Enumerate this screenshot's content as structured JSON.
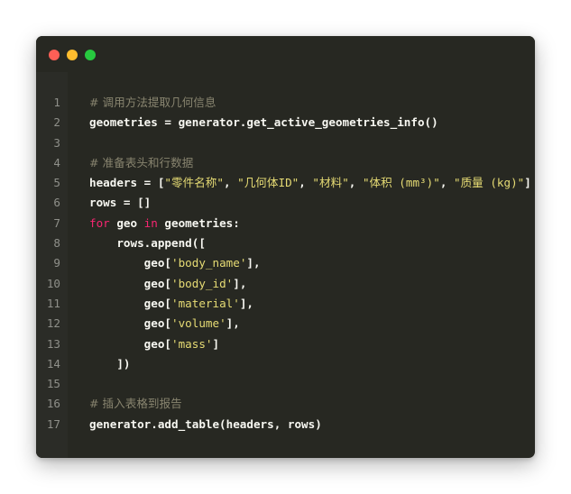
{
  "window": {
    "traffic_lights": [
      {
        "name": "close",
        "color": "#ff5f56"
      },
      {
        "name": "minimize",
        "color": "#ffbd2e"
      },
      {
        "name": "maximize",
        "color": "#27c93f"
      }
    ]
  },
  "theme": {
    "background": "#272822",
    "text": "#f8f8f2",
    "string": "#e6db74",
    "keyword": "#f92672",
    "comment": "#88846f",
    "line_number": "#8f908a"
  },
  "code": {
    "lines": [
      {
        "number": "1",
        "tokens": [
          {
            "t": "cm",
            "v": "# 调用方法提取几何信息"
          }
        ]
      },
      {
        "number": "2",
        "tokens": [
          {
            "t": "code",
            "v": "geometries = generator.get_active_geometries_info()"
          }
        ]
      },
      {
        "number": "3",
        "tokens": []
      },
      {
        "number": "4",
        "tokens": [
          {
            "t": "cm",
            "v": "# 准备表头和行数据"
          }
        ]
      },
      {
        "number": "5",
        "tokens": [
          {
            "t": "code",
            "v": "headers = ["
          },
          {
            "t": "str",
            "v": "\"零件名称\""
          },
          {
            "t": "code",
            "v": ", "
          },
          {
            "t": "str",
            "v": "\"几何体ID\""
          },
          {
            "t": "code",
            "v": ", "
          },
          {
            "t": "str",
            "v": "\"材料\""
          },
          {
            "t": "code",
            "v": ", "
          },
          {
            "t": "str",
            "v": "\"体积 (mm³)\""
          },
          {
            "t": "code",
            "v": ", "
          },
          {
            "t": "str",
            "v": "\"质量 (kg)\""
          },
          {
            "t": "code",
            "v": "]"
          }
        ]
      },
      {
        "number": "6",
        "tokens": [
          {
            "t": "code",
            "v": "rows = []"
          }
        ]
      },
      {
        "number": "7",
        "tokens": [
          {
            "t": "kw",
            "v": "for"
          },
          {
            "t": "code",
            "v": " geo "
          },
          {
            "t": "kw",
            "v": "in"
          },
          {
            "t": "code",
            "v": " geometries:"
          }
        ]
      },
      {
        "number": "8",
        "tokens": [
          {
            "t": "code",
            "v": "    rows.append(["
          }
        ]
      },
      {
        "number": "9",
        "tokens": [
          {
            "t": "code",
            "v": "        geo["
          },
          {
            "t": "str",
            "v": "'body_name'"
          },
          {
            "t": "code",
            "v": "],"
          }
        ]
      },
      {
        "number": "10",
        "tokens": [
          {
            "t": "code",
            "v": "        geo["
          },
          {
            "t": "str",
            "v": "'body_id'"
          },
          {
            "t": "code",
            "v": "],"
          }
        ]
      },
      {
        "number": "11",
        "tokens": [
          {
            "t": "code",
            "v": "        geo["
          },
          {
            "t": "str",
            "v": "'material'"
          },
          {
            "t": "code",
            "v": "],"
          }
        ]
      },
      {
        "number": "12",
        "tokens": [
          {
            "t": "code",
            "v": "        geo["
          },
          {
            "t": "str",
            "v": "'volume'"
          },
          {
            "t": "code",
            "v": "],"
          }
        ]
      },
      {
        "number": "13",
        "tokens": [
          {
            "t": "code",
            "v": "        geo["
          },
          {
            "t": "str",
            "v": "'mass'"
          },
          {
            "t": "code",
            "v": "]"
          }
        ]
      },
      {
        "number": "14",
        "tokens": [
          {
            "t": "code",
            "v": "    ])"
          }
        ]
      },
      {
        "number": "15",
        "tokens": []
      },
      {
        "number": "16",
        "tokens": [
          {
            "t": "cm",
            "v": "# 插入表格到报告"
          }
        ]
      },
      {
        "number": "17",
        "tokens": [
          {
            "t": "code",
            "v": "generator.add_table(headers, rows)"
          }
        ]
      }
    ]
  }
}
